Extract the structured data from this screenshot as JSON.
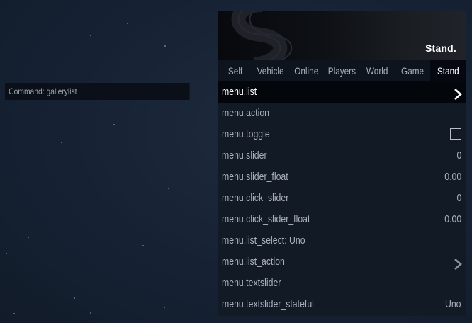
{
  "console": {
    "text": "Command: gallerylist"
  },
  "menu": {
    "brand": "Stand.",
    "tabs": [
      {
        "label": "Self"
      },
      {
        "label": "Vehicle"
      },
      {
        "label": "Online"
      },
      {
        "label": "Players"
      },
      {
        "label": "World"
      },
      {
        "label": "Game"
      },
      {
        "label": "Stand",
        "active": true
      }
    ],
    "items": [
      {
        "label": "menu.list",
        "kind": "submenu",
        "active": true
      },
      {
        "label": "menu.action",
        "kind": "action"
      },
      {
        "label": "menu.toggle",
        "kind": "toggle",
        "checked": false
      },
      {
        "label": "menu.slider",
        "kind": "value",
        "value": "0"
      },
      {
        "label": "menu.slider_float",
        "kind": "value",
        "value": "0.00"
      },
      {
        "label": "menu.click_slider",
        "kind": "value",
        "value": "0"
      },
      {
        "label": "menu.click_slider_float",
        "kind": "value",
        "value": "0.00"
      },
      {
        "label": "menu.list_select: Uno",
        "kind": "action"
      },
      {
        "label": "menu.list_action",
        "kind": "submenu"
      },
      {
        "label": "menu.textslider",
        "kind": "action"
      },
      {
        "label": "menu.textslider_stateful",
        "kind": "value",
        "value": "Uno"
      }
    ],
    "colors": {
      "accent_text": "#ffffff",
      "muted_text": "#a9b0ba",
      "panel": "#121a26",
      "active_row": "#03060b"
    }
  }
}
